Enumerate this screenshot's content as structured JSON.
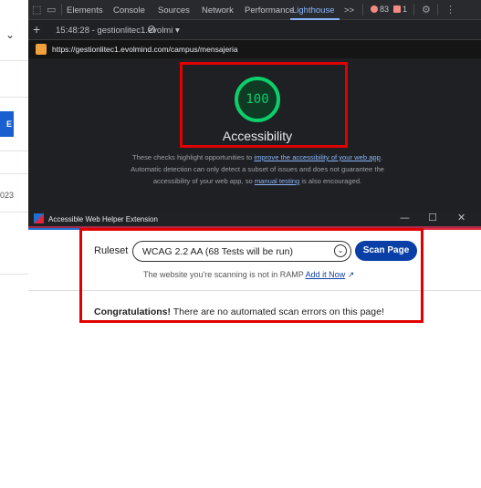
{
  "left_page": {
    "chevron": "⌄",
    "button_label": "E",
    "year_text": "023"
  },
  "devtools": {
    "tabs": [
      "Elements",
      "Console",
      "Sources",
      "Network",
      "Performance",
      "Lighthouse"
    ],
    "more_tabs": ">>",
    "errors_count": "83",
    "warnings_count": "1",
    "session_label": "15:48:28 - gestionlitec1.evolmi ▾",
    "report_url": "https://gestionlitec1.evolmind.com/campus/mensajeria",
    "score": "100",
    "category_title": "Accessibility",
    "description": {
      "t1": "These checks highlight opportunities to ",
      "l1": "improve the accessibility of your web app",
      "t2": ". Automatic detection can only detect a subset of issues and does not guarantee the accessibility of your web app, so ",
      "l2": "manual testing",
      "t3": " is also encouraged."
    },
    "colors": {
      "score_green": "#0cce6b",
      "highlight_red": "#e00000",
      "link_blue": "#8ab4f8"
    }
  },
  "extension": {
    "window_title": "Accessible Web Helper Extension",
    "min": "—",
    "max": "☐",
    "close": "✕",
    "ruleset_label": "Ruleset",
    "ruleset_value": "WCAG 2.2 AA (68 Tests will be run)",
    "scan_button": "Scan Page",
    "ramp_note": "The website you're scanning is not in RAMP",
    "ramp_link": "Add it Now",
    "congrats_bold": "Congratulations!",
    "congrats_text": " There are no automated scan errors on this page!",
    "colors": {
      "primary": "#0b3fa8"
    }
  }
}
